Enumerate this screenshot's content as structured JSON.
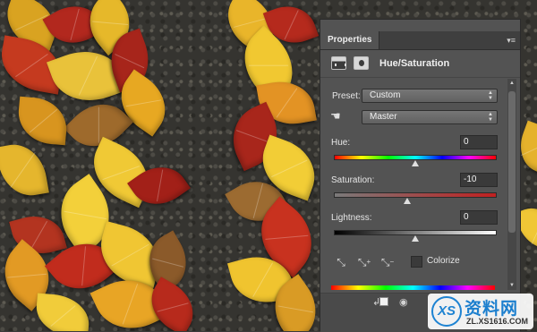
{
  "panel": {
    "tab_label": "Properties",
    "collapse_glyph": "◂◂",
    "close_glyph": "✕",
    "menu_glyph": "▾≡",
    "adjustment_title": "Hue/Saturation",
    "preset_label": "Preset:",
    "preset_value": "Custom",
    "channel_value": "Master",
    "hue_label": "Hue:",
    "hue_value": "0",
    "saturation_label": "Saturation:",
    "saturation_value": "-10",
    "lightness_label": "Lightness:",
    "lightness_value": "0",
    "colorize_label": "Colorize",
    "colorize_checked": false
  },
  "sliders": {
    "hue_fraction": 0.5,
    "saturation_fraction": 0.45,
    "lightness_fraction": 0.5
  },
  "icons": {
    "targeted_adjustment": "hand-icon",
    "eyedropper": "eyedropper-icon",
    "eyedropper_add": "eyedropper-plus-icon",
    "eyedropper_subtract": "eyedropper-minus-icon",
    "clip": "clip-to-layer-icon",
    "visibility": "eye-icon"
  },
  "colors": {
    "panel_bg": "#535353",
    "tab_bar": "#3f3f3f",
    "field_bg": "#3a3a3a"
  },
  "watermark": {
    "logo_text": "XS",
    "cn_text": "资料网",
    "url_text": "ZL.XS1616.COM"
  }
}
